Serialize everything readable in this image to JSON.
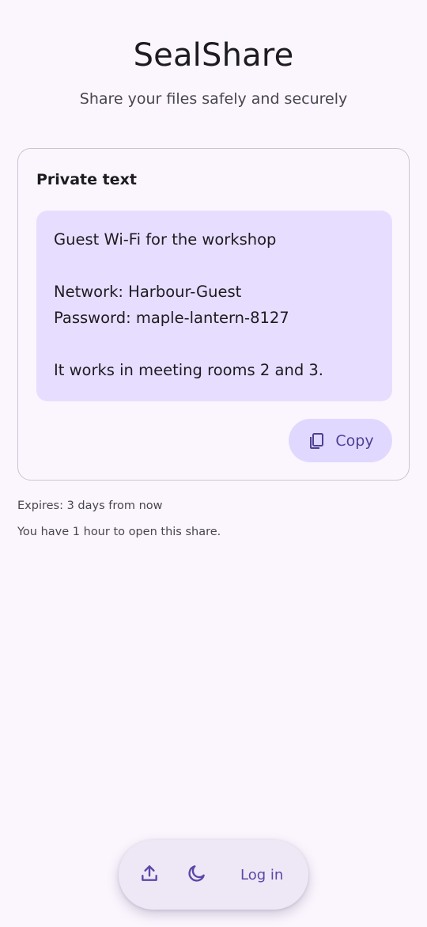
{
  "app": {
    "title": "SealShare",
    "subtitle": "Share your files safely and securely"
  },
  "card": {
    "title": "Private text",
    "lines": [
      "Guest Wi-Fi for the workshop",
      "",
      "Network: Harbour-Guest",
      "Password: maple-lantern-8127",
      "",
      "It works in meeting rooms 2 and 3."
    ],
    "copy_label": "Copy",
    "copy_icon": "copy-icon"
  },
  "info": {
    "expires": "Expires: 3 days from now",
    "open_window": "You have 1 hour to open this share."
  },
  "bottom_bar": {
    "upload_icon": "upload-icon",
    "theme_icon": "dark-mode-moon-icon",
    "login_label": "Log in"
  },
  "colors": {
    "background": "#fbf6fe",
    "text_box": "#e7deff",
    "accent": "#5c47a8",
    "copy_button": "#e1d8ff"
  }
}
